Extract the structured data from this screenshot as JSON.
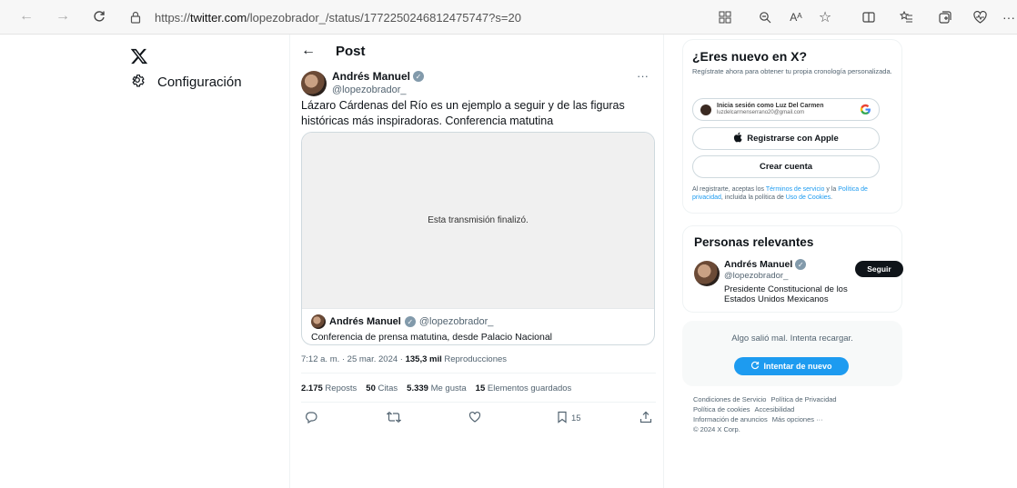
{
  "browser": {
    "url_prefix": "https://",
    "url_domain": "twitter.com",
    "url_path": "/lopezobrador_/status/1772250246812475747?s=20",
    "reader_label": "Aᴬ"
  },
  "left_nav": {
    "settings_label": "Configuración"
  },
  "post": {
    "header_title": "Post",
    "author_name": "Andrés Manuel",
    "author_handle": "@lopezobrador_",
    "more": "···",
    "text": "Lázaro Cárdenas del Río es un ejemplo a seguir y de las figuras históricas más inspiradoras. Conferencia matutina",
    "media": {
      "status_text": "Esta transmisión finalizó.",
      "host_name": "Andrés Manuel",
      "host_handle": "@lopezobrador_",
      "description": "Conferencia de prensa matutina, desde Palacio Nacional"
    },
    "timestamp": "7:12 a. m. · 25 mar. 2024 · ",
    "views_count": "135,3 mil",
    "views_label": " Reproducciones",
    "stats": [
      {
        "count": "2.175",
        "label": " Reposts"
      },
      {
        "count": "50",
        "label": " Citas"
      },
      {
        "count": "5.339",
        "label": " Me gusta"
      },
      {
        "count": "15",
        "label": " Elementos guardados"
      }
    ],
    "bookmark_count": "15"
  },
  "signup": {
    "title": "¿Eres nuevo en X?",
    "description": "Regístrate ahora para obtener tu propia cronología personalizada.",
    "google_line1": "Inicia sesión como Luz Del Carmen",
    "google_line2": "luzdelcarmenserrano20@gmail.com",
    "apple_label": "Registrarse con Apple",
    "create_label": "Crear cuenta",
    "legal_pre": "Al registrarte, aceptas los ",
    "legal_terms": "Términos de servicio",
    "legal_mid1": " y la ",
    "legal_privacy": "Política de privacidad",
    "legal_mid2": ", incluida la política de ",
    "legal_cookies": "Uso de Cookies",
    "legal_end": "."
  },
  "people": {
    "title": "Personas relevantes",
    "name": "Andrés Manuel",
    "handle": "@lopezobrador_",
    "bio": "Presidente Constitucional de los Estados Unidos Mexicanos",
    "follow_label": "Seguir"
  },
  "error": {
    "message": "Algo salió mal. Intenta recargar.",
    "retry_label": "Intentar de nuevo"
  },
  "footer": {
    "line1": [
      "Condiciones de Servicio",
      "Política de Privacidad"
    ],
    "line2": [
      "Política de cookies",
      "Accesibilidad"
    ],
    "line3": [
      "Información de anuncios",
      "Más opciones ···"
    ],
    "copyright": "© 2024 X Corp."
  },
  "colors": {
    "accent": "#1d9bf0",
    "text": "#0f1419",
    "muted": "#536471"
  }
}
